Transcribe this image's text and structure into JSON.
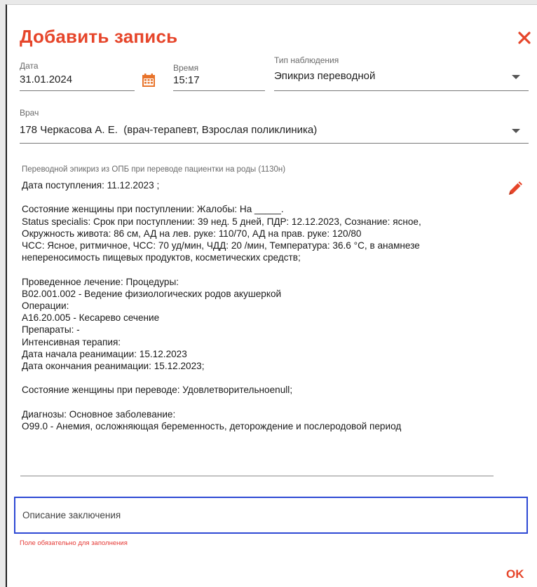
{
  "dialog": {
    "title": "Добавить запись",
    "ok_label": "OK"
  },
  "fields": {
    "date": {
      "label": "Дата",
      "value": "31.01.2024"
    },
    "time": {
      "label": "Время",
      "value": "15:17"
    },
    "observation_type": {
      "label": "Тип наблюдения",
      "value": "Эпикриз переводной"
    },
    "doctor": {
      "label": "Врач",
      "value": "178 Черкасова А. Е.  (врач-терапевт, Взрослая поликлиника)"
    }
  },
  "epicrisis": {
    "label": "Переводной эпикриз из ОПБ при переводе пациентки на роды (1130н)",
    "text": "Дата поступления: 11.12.2023 ;\n\nСостояние женщины при поступлении: Жалобы: На _____.\nStatus specialis: Срок при поступлении: 39 нед. 5 дней, ПДР: 12.12.2023, Сознание: ясное,\nОкружность живота: 86 см, АД на лев. руке: 110/70, АД на прав. руке: 120/80\nЧСС: Ясное, ритмичное, ЧСС: 70 уд/мин, ЧДД: 20 /мин, Температура: 36.6 °С, в анамнезе\nнепереносимость пищевых продуктов, косметических средств;\n\nПроведенное лечение: Процедуры:\nB02.001.002 - Ведение физиологических родов акушеркой\nОперации:\nA16.20.005 - Кесарево сечение\nПрепараты: -\nИнтенсивная терапия:\nДата начала реанимации: 15.12.2023\nДата окончания реанимации: 15.12.2023;\n\nСостояние женщины при переводе: Удовлетворительноеnull;\n\nДиагнозы: Основное заболевание:\nO99.0 - Анемия, осложняющая беременность, деторождение и послеродовой период"
  },
  "conclusion": {
    "placeholder": "Описание заключения",
    "error": "Поле обязательно для заполнения"
  },
  "colors": {
    "accent": "#e6452a",
    "focus_border": "#2d48d4",
    "error": "#e53935",
    "calendar_icon": "#e8732a"
  },
  "icons": {
    "close": "close-icon",
    "calendar": "calendar-icon",
    "edit": "pencil-icon",
    "dropdown": "chevron-down-icon"
  }
}
